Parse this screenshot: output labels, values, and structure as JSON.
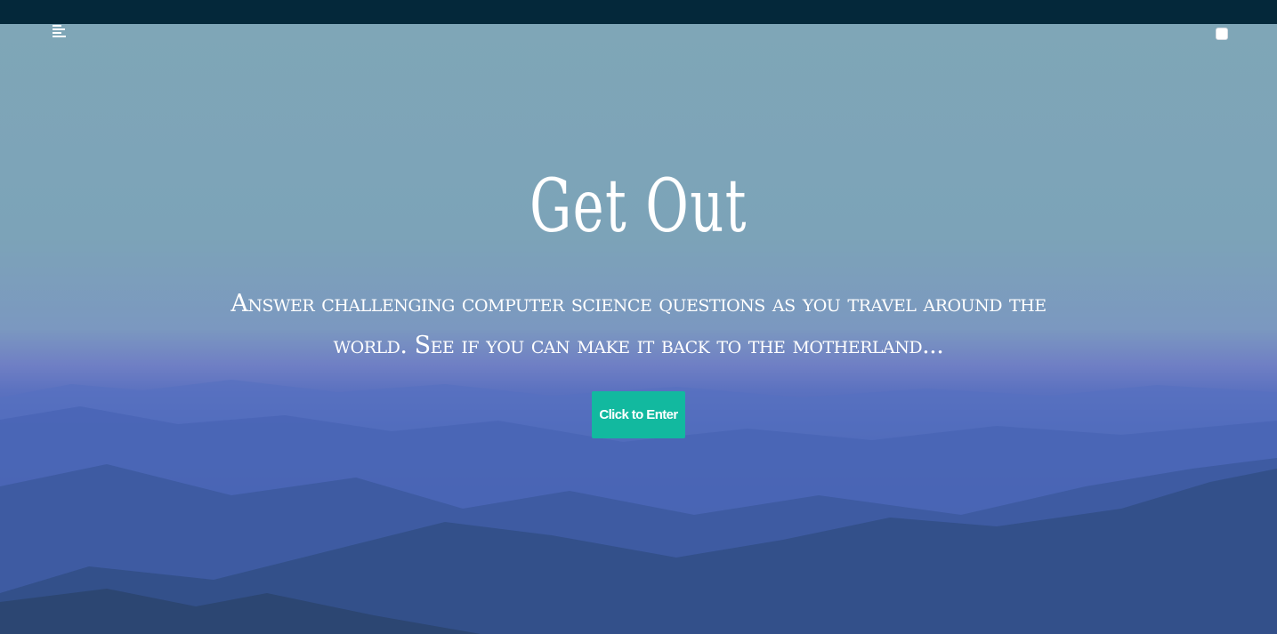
{
  "top_bar": {
    "color": "#04283a"
  },
  "header": {
    "menu_icon": "hamburger-menu-icon",
    "checkbox_checked": false
  },
  "hero": {
    "title": "Get Out",
    "subtitle": "Answer challenging computer science questions as you travel around the world. See if you can make it back to the motherland...",
    "enter_button_label": "Click to Enter",
    "button_color": "#12b99f",
    "background_description_colors": {
      "sky": "#7fa6b7",
      "horizon": "#5c72c0",
      "mountains": "#2f4a73"
    }
  }
}
